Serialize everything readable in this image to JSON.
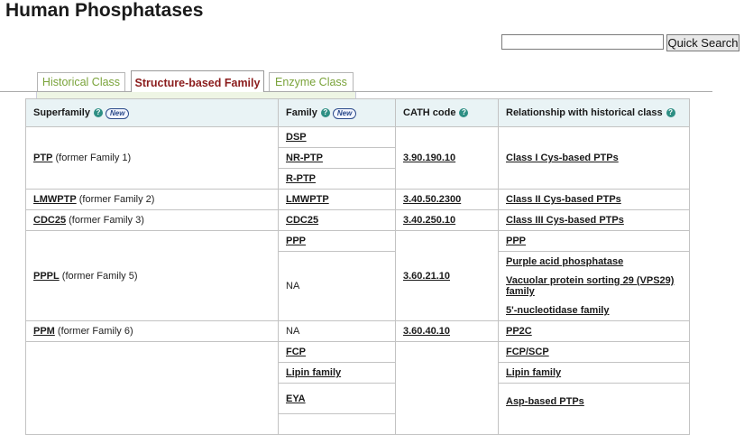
{
  "page": {
    "title": "Human Phosphatases"
  },
  "search": {
    "value": "",
    "button_label": "Quick Search"
  },
  "tabs": [
    {
      "label": "Historical Class"
    },
    {
      "label": "Structure-based Family",
      "active": true
    },
    {
      "label": "Enzyme Class"
    }
  ],
  "table": {
    "headers": {
      "superfamily": "Superfamily",
      "family": "Family",
      "cath": "CATH code",
      "relationship": "Relationship with historical class",
      "new_badge": "New",
      "help_icon": "help-icon"
    },
    "rows": {
      "ptp": {
        "superfamily_link": "PTP",
        "superfamily_note": "(former Family 1)",
        "families": [
          "DSP",
          "NR-PTP",
          "R-PTP"
        ],
        "cath": "3.90.190.10",
        "relationship": "Class I Cys-based PTPs"
      },
      "lmwptp": {
        "superfamily_link": "LMWPTP",
        "superfamily_note": "(former Family 2)",
        "family": "LMWPTP",
        "cath": "3.40.50.2300",
        "relationship": "Class II Cys-based PTPs"
      },
      "cdc25": {
        "superfamily_link": "CDC25",
        "superfamily_note": "(former Family 3)",
        "family": "CDC25",
        "cath": "3.40.250.10",
        "relationship": "Class III Cys-based PTPs"
      },
      "pppl": {
        "superfamily_link": "PPPL",
        "superfamily_note": "(former Family 5)",
        "family_ppp": "PPP",
        "family_na": "NA",
        "cath": "3.60.21.10",
        "relationship_ppp": "PPP",
        "relationships_na": [
          "Purple acid phosphatase",
          "Vacuolar protein sorting 29 (VPS29) family",
          "5'-nucleotidase family"
        ]
      },
      "ppm": {
        "superfamily_link": "PPM",
        "superfamily_note": "(former Family 6)",
        "family": "NA",
        "cath": "3.60.40.10",
        "relationship": "PP2C"
      },
      "haloacid": {
        "families": [
          "FCP",
          "Lipin family",
          "EYA"
        ],
        "relationships": [
          "FCP/SCP",
          "Lipin family",
          "Asp-based PTPs"
        ]
      }
    }
  }
}
